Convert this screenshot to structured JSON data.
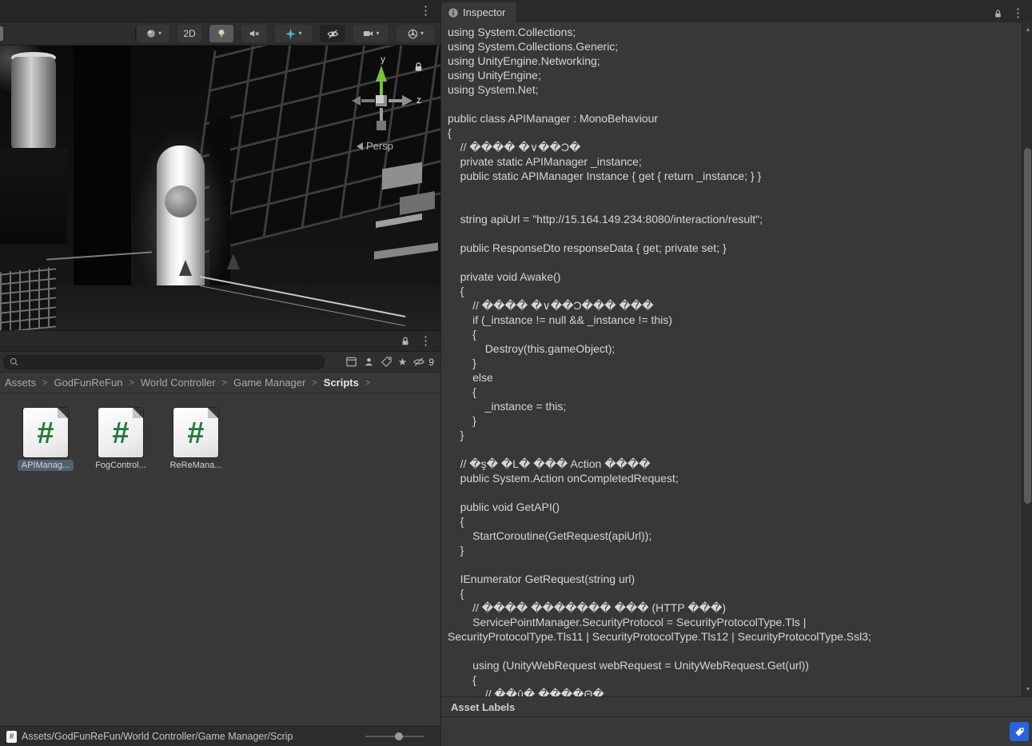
{
  "icons": {
    "kebab": "⋮",
    "caret": "▾",
    "star": "★",
    "crumb_sep": ">",
    "scroll_up": "▲",
    "scroll_down": "▼"
  },
  "scene": {
    "toolbar": {
      "btn_2d": "2D"
    },
    "gizmo": {
      "y_label": "y",
      "z_label": "z",
      "persp_label": "Persp"
    }
  },
  "project": {
    "script_hash": "#",
    "breadcrumb": [
      {
        "label": "Assets"
      },
      {
        "label": "GodFunReFun"
      },
      {
        "label": "World Controller"
      },
      {
        "label": "Game Manager"
      },
      {
        "label": "Scripts",
        "active": true
      }
    ],
    "assets": [
      {
        "name": "APIManag...",
        "selected": true
      },
      {
        "name": "FogControl..."
      },
      {
        "name": "ReReMana..."
      }
    ],
    "hidden_count": "9",
    "status_path": "Assets/GodFunReFun/World Controller/Game Manager/Scrip"
  },
  "inspector": {
    "tab_label": "Inspector",
    "asset_labels_title": "Asset Labels",
    "code_lines": [
      "using System.Collections;",
      "using System.Collections.Generic;",
      "using UnityEngine.Networking;",
      "using UnityEngine;",
      "using System.Net;",
      "",
      "public class APIManager : MonoBehaviour",
      "{",
      "    // ���� �∨��Ɔ�",
      "    private static APIManager _instance;",
      "    public static APIManager Instance { get { return _instance; } }",
      "",
      "",
      "    string apiUrl = \"http://15.164.149.234:8080/interaction/result\";",
      "",
      "    public ResponseDto responseData { get; private set; }",
      "",
      "    private void Awake()",
      "    {",
      "        // ���� �∨��Ɔ��� ���",
      "        if (_instance != null && _instance != this)",
      "        {",
      "            Destroy(this.gameObject);",
      "        }",
      "        else",
      "        {",
      "            _instance = this;",
      "        }",
      "    }",
      "",
      "    // �ş� �L� ��� Action ����",
      "    public System.Action onCompletedRequest;",
      "",
      "    public void GetAPI()",
      "    {",
      "        StartCoroutine(GetRequest(apiUrl));",
      "    }",
      "",
      "    IEnumerator GetRequest(string url)",
      "    {",
      "        // ���� ������� ��� (HTTP ���)",
      "        ServicePointManager.SecurityProtocol = SecurityProtocolType.Tls |",
      "SecurityProtocolType.Tls11 | SecurityProtocolType.Tls12 | SecurityProtocolType.Ssl3;",
      "",
      "        using (UnityWebRequest webRequest = UnityWebRequest.Get(url))",
      "        {",
      "            // ��û� ����Θ�."
    ]
  }
}
